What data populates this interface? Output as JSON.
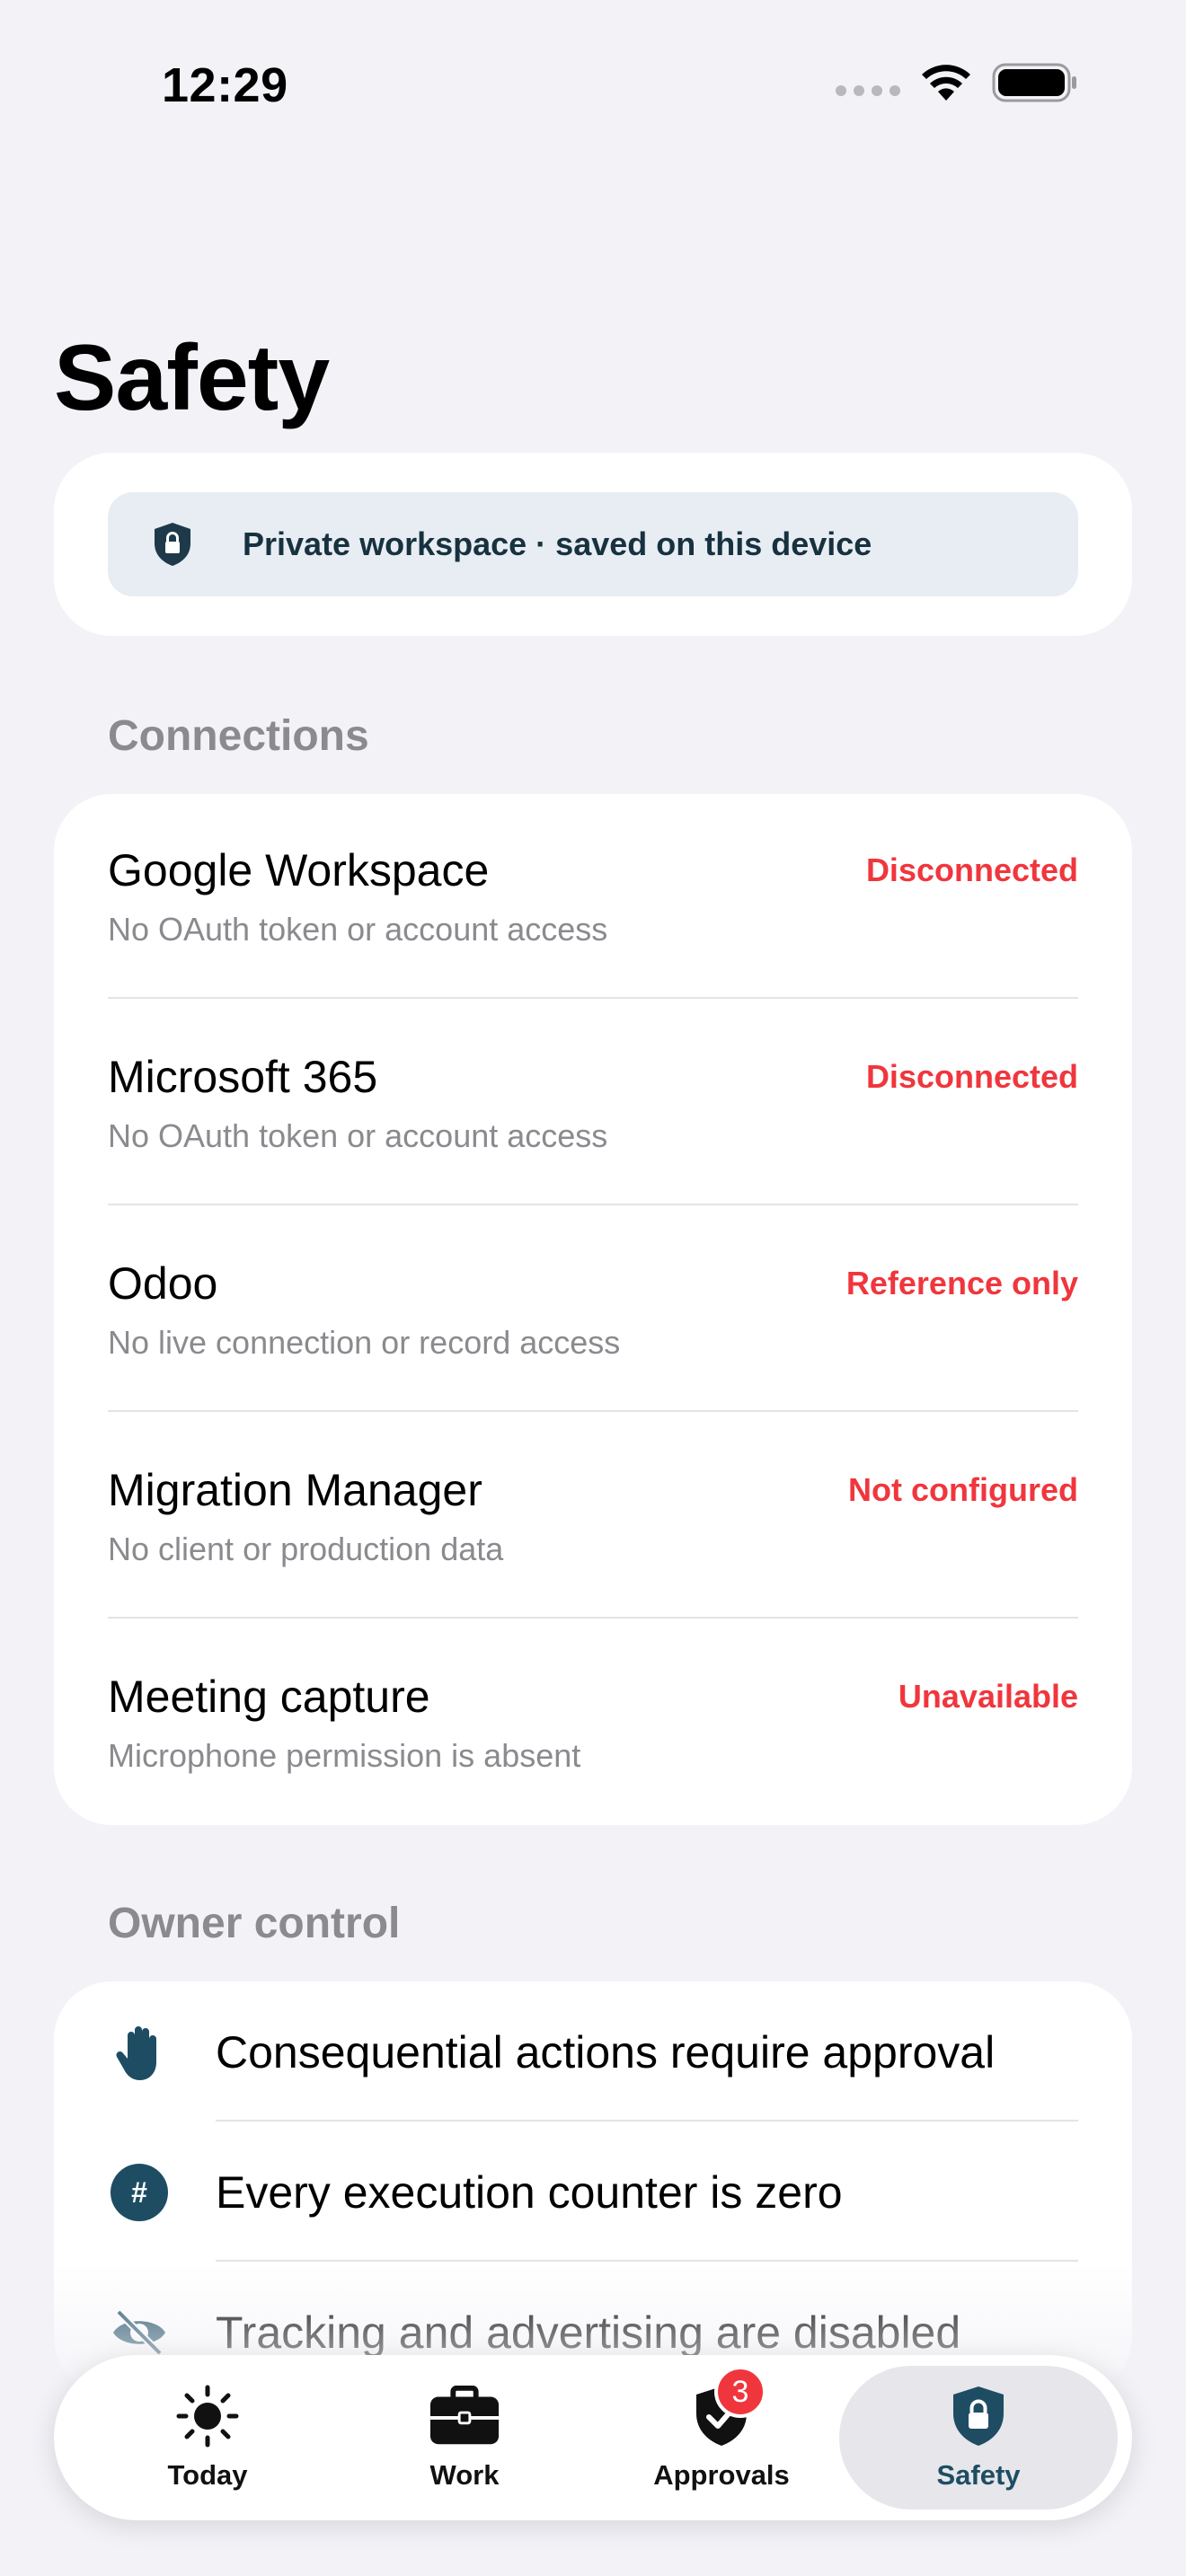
{
  "status_bar": {
    "time": "12:29"
  },
  "page": {
    "title": "Safety"
  },
  "banner": {
    "text": "Private workspace · saved on this device"
  },
  "connections": {
    "label": "Connections",
    "items": [
      {
        "name": "Google Workspace",
        "desc": "No OAuth token or account access",
        "status": "Disconnected"
      },
      {
        "name": "Microsoft 365",
        "desc": "No OAuth token or account access",
        "status": "Disconnected"
      },
      {
        "name": "Odoo",
        "desc": "No live connection or record access",
        "status": "Reference only"
      },
      {
        "name": "Migration Manager",
        "desc": "No client or production data",
        "status": "Not configured"
      },
      {
        "name": "Meeting capture",
        "desc": "Microphone permission is absent",
        "status": "Unavailable"
      }
    ]
  },
  "owner_control": {
    "label": "Owner control",
    "items": [
      {
        "icon": "hand-raised-icon",
        "text": "Consequential actions require approval"
      },
      {
        "icon": "number-sign-icon",
        "text": "Every execution counter is zero"
      },
      {
        "icon": "eye-slash-icon",
        "text": "Tracking and advertising are disabled"
      }
    ]
  },
  "tabbar": {
    "tabs": [
      {
        "label": "Today",
        "icon": "sun-icon"
      },
      {
        "label": "Work",
        "icon": "briefcase-icon"
      },
      {
        "label": "Approvals",
        "icon": "checkmark-shield-icon",
        "badge": "3"
      },
      {
        "label": "Safety",
        "icon": "lock-shield-icon",
        "active": true
      }
    ]
  },
  "colors": {
    "accent": "#1e4d63",
    "alert": "#f0363d",
    "background": "#f2f2f7",
    "banner_bg": "#e7edf3"
  }
}
